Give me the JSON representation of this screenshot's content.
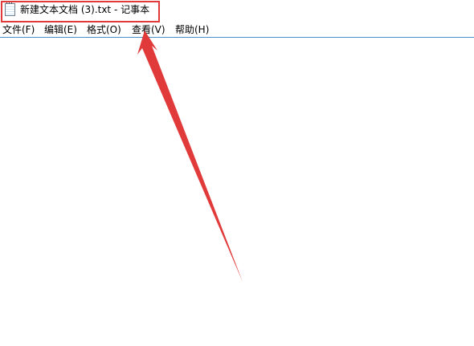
{
  "window": {
    "title": "新建文本文档 (3).txt - 记事本",
    "icon": "notepad-icon"
  },
  "menu": {
    "items": [
      {
        "label": "文件(F)"
      },
      {
        "label": "编辑(E)"
      },
      {
        "label": "格式(O)"
      },
      {
        "label": "查看(V)"
      },
      {
        "label": "帮助(H)"
      }
    ]
  },
  "editor": {
    "content": ""
  },
  "colors": {
    "annotation": "#e03a3a",
    "menu_border": "#4a90c9"
  }
}
